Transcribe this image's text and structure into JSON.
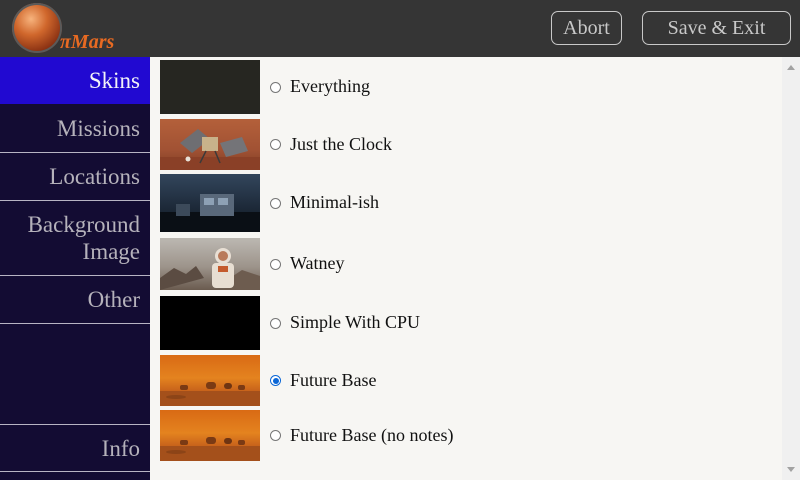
{
  "app": {
    "title": "πMars"
  },
  "header": {
    "abort_label": "Abort",
    "save_exit_label": "Save & Exit"
  },
  "sidebar": {
    "items": [
      {
        "label": "Skins",
        "active": true
      },
      {
        "label": "Missions"
      },
      {
        "label": "Locations"
      },
      {
        "label": "Background\nImage"
      },
      {
        "label": "Other"
      }
    ],
    "info_label": "Info"
  },
  "skins": [
    {
      "label": "Everything",
      "selected": false
    },
    {
      "label": "Just the Clock",
      "selected": false
    },
    {
      "label": "Minimal-ish",
      "selected": false
    },
    {
      "label": "Watney",
      "selected": false
    },
    {
      "label": "Simple With CPU",
      "selected": false
    },
    {
      "label": "Future Base",
      "selected": true
    },
    {
      "label": "Future Base (no notes)",
      "selected": false
    }
  ],
  "colors": {
    "header_bg": "#353535",
    "sidebar_bg": "#130c33",
    "sidebar_active": "#2109d1",
    "logo_text": "#e86a22",
    "radio_checked": "#0a66d6"
  }
}
